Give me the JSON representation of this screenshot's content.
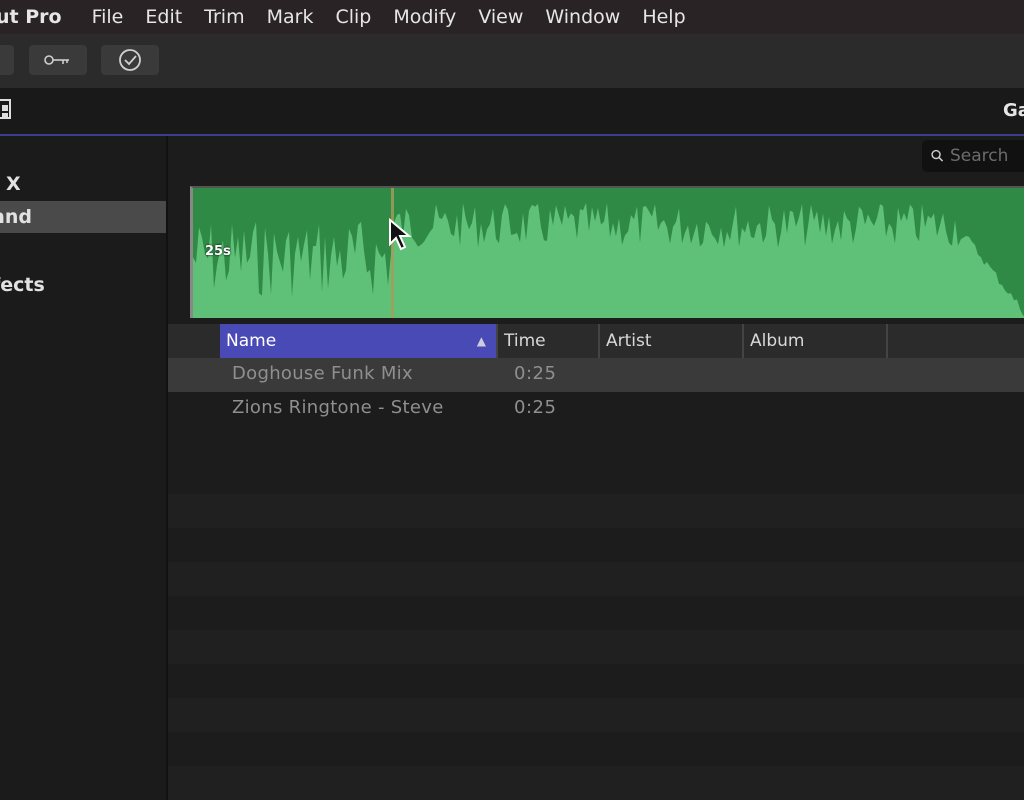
{
  "menubar": {
    "app_name": "ut Pro",
    "items": [
      "File",
      "Edit",
      "Trim",
      "Mark",
      "Clip",
      "Modify",
      "View",
      "Window",
      "Help"
    ]
  },
  "browser": {
    "header_right": "Ga"
  },
  "sidebar": {
    "items": [
      {
        "label": "X"
      },
      {
        "label": "and",
        "selected": true
      },
      {
        "label": "fects"
      }
    ]
  },
  "search": {
    "placeholder": "Search"
  },
  "waveform": {
    "duration_label": "25s",
    "colors": {
      "fill": "#5fc077",
      "peaks": "#2f8a45"
    }
  },
  "table": {
    "columns": [
      "Name",
      "Time",
      "Artist",
      "Album"
    ],
    "sort_column": "Name",
    "rows": [
      {
        "name": "Doghouse Funk Mix",
        "time": "0:25",
        "selected": true
      },
      {
        "name": "Zions Ringtone - Steve",
        "time": "0:25"
      }
    ]
  },
  "colors": {
    "accent": "#4a4ab6",
    "menubar": "#2a2326"
  }
}
